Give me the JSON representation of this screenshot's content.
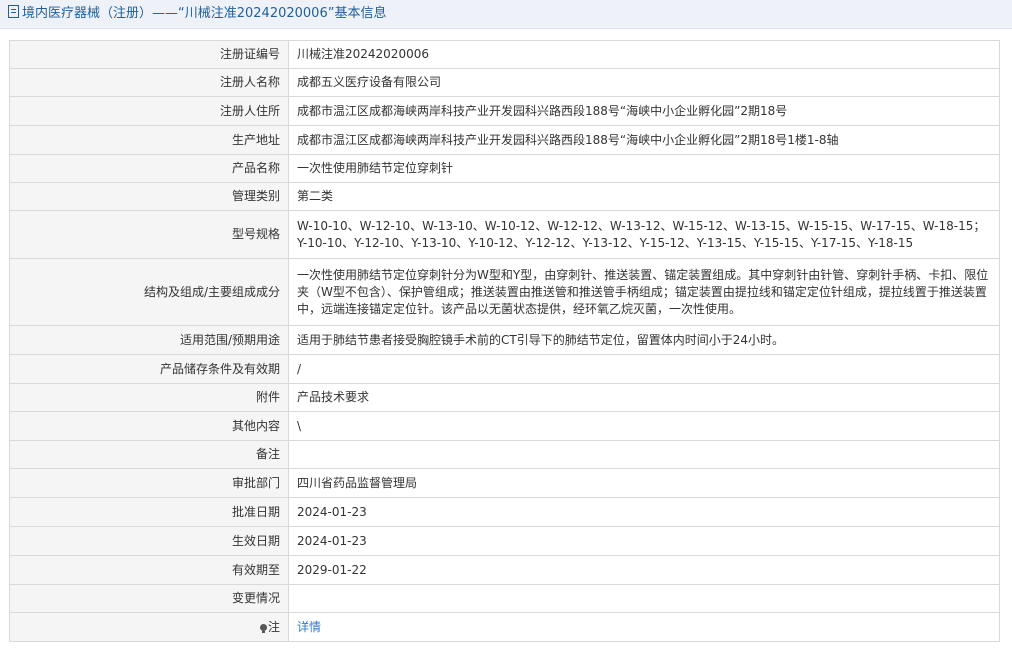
{
  "header": {
    "title": "境内医疗器械（注册）——“川械注准20242020006”基本信息",
    "icon": "document-icon"
  },
  "rows": [
    {
      "label": "注册证编号",
      "value": "川械注准20242020006"
    },
    {
      "label": "注册人名称",
      "value": "成都五义医疗设备有限公司"
    },
    {
      "label": "注册人住所",
      "value": "成都市温江区成都海峡两岸科技产业开发园科兴路西段188号“海峡中小企业孵化园”2期18号"
    },
    {
      "label": "生产地址",
      "value": "成都市温江区成都海峡两岸科技产业开发园科兴路西段188号“海峡中小企业孵化园”2期18号1楼1-8轴"
    },
    {
      "label": "产品名称",
      "value": "一次性使用肺结节定位穿刺针"
    },
    {
      "label": "管理类别",
      "value": "第二类"
    },
    {
      "label": "型号规格",
      "value": "W-10-10、W-12-10、W-13-10、W-10-12、W-12-12、W-13-12、W-15-12、W-13-15、W-15-15、W-17-15、W-18-15；Y-10-10、Y-12-10、Y-13-10、Y-10-12、Y-12-12、Y-13-12、Y-15-12、Y-13-15、Y-15-15、Y-17-15、Y-18-15"
    },
    {
      "label": "结构及组成/主要组成成分",
      "value": "一次性使用肺结节定位穿刺针分为W型和Y型，由穿刺针、推送装置、锚定装置组成。其中穿刺针由针管、穿刺针手柄、卡扣、限位夹（W型不包含）、保护管组成；推送装置由推送管和推送管手柄组成；锚定装置由提拉线和锚定定位针组成，提拉线置于推送装置中，远端连接锚定定位针。该产品以无菌状态提供，经环氧乙烷灭菌，一次性使用。"
    },
    {
      "label": "适用范围/预期用途",
      "value": "适用于肺结节患者接受胸腔镜手术前的CT引导下的肺结节定位，留置体内时间小于24小时。"
    },
    {
      "label": "产品储存条件及有效期",
      "value": "/"
    },
    {
      "label": "附件",
      "value": "产品技术要求"
    },
    {
      "label": "其他内容",
      "value": "\\"
    },
    {
      "label": "备注",
      "value": ""
    },
    {
      "label": "审批部门",
      "value": "四川省药品监督管理局"
    },
    {
      "label": "批准日期",
      "value": "2024-01-23"
    },
    {
      "label": "生效日期",
      "value": "2024-01-23"
    },
    {
      "label": "有效期至",
      "value": "2029-01-22"
    },
    {
      "label": "变更情况",
      "value": ""
    }
  ],
  "note": {
    "label": "注",
    "icon": "lightbulb-icon",
    "link": "详情"
  },
  "colors": {
    "header_text": "#1f5f9c",
    "header_bg": "#eef2f8",
    "label_bg": "#f5f5f5",
    "border": "#d9d9d9",
    "link": "#2a7bd0"
  }
}
